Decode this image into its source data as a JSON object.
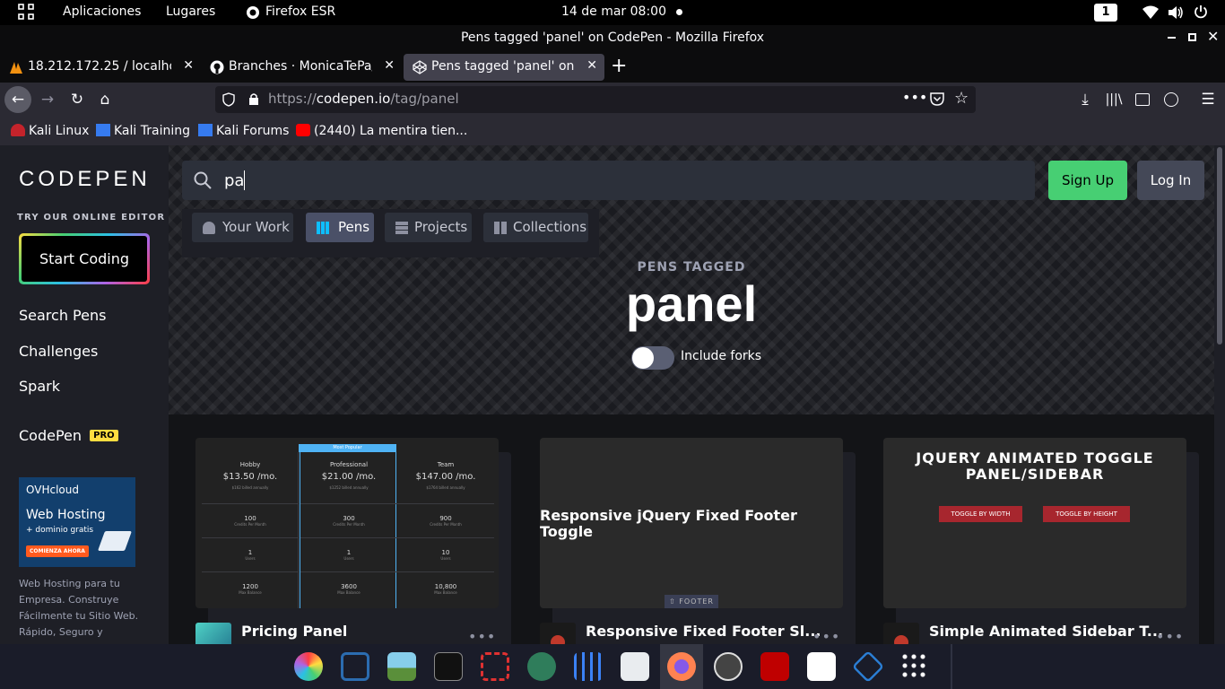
{
  "topbar": {
    "applications": "Aplicaciones",
    "places": "Lugares",
    "browser_app": "Firefox ESR",
    "datetime": "14 de mar  08:00",
    "workspace": "1"
  },
  "window": {
    "title": "Pens tagged 'panel' on CodePen - Mozilla Firefox"
  },
  "tabs": [
    {
      "label": "18.212.172.25 / localhost",
      "active": false
    },
    {
      "label": "Branches · MonicaTePa/F",
      "active": false
    },
    {
      "label": "Pens tagged 'panel' on Co",
      "active": true
    }
  ],
  "urlbar": {
    "url": "https://codepen.io/tag/panel",
    "url_host": "codepen.io",
    "url_prefix": "https://",
    "url_path": "/tag/panel"
  },
  "bookmarks": [
    {
      "label": "Kali Linux"
    },
    {
      "label": "Kali Training"
    },
    {
      "label": "Kali Forums"
    },
    {
      "label": "(2440) La mentira tien..."
    }
  ],
  "sidebar": {
    "logo": "CODEPEN",
    "try_label": "TRY OUR ONLINE EDITOR",
    "start_coding": "Start Coding",
    "links": [
      "Search Pens",
      "Challenges",
      "Spark"
    ],
    "codepen": "CodePen",
    "pro_badge": "PRO",
    "ad": {
      "brand": "OVHcloud",
      "headline": "Web Hosting",
      "subline": "+ dominio gratis",
      "cta": "COMIENZA AHORA",
      "text": "Web Hosting para tu Empresa. Construye Fácilmente tu Sitio Web. Rápido, Seguro y"
    }
  },
  "search": {
    "value": "pa",
    "tabs": [
      {
        "label": "Your Work",
        "active": false
      },
      {
        "label": "Pens",
        "active": true
      },
      {
        "label": "Projects",
        "active": false
      },
      {
        "label": "Collections",
        "active": false
      }
    ]
  },
  "header_buttons": {
    "sign_up": "Sign Up",
    "log_in": "Log In"
  },
  "hero": {
    "eyebrow": "PENS TAGGED",
    "tag": "panel",
    "toggle_label": "Include forks",
    "toggle_on": false
  },
  "cards": [
    {
      "title": "Pricing Panel",
      "more": "•••",
      "preview": {
        "popular": "Most Popular",
        "plans": [
          {
            "name": "Hobby",
            "price": "$13.50 /mo.",
            "billed": "$162 billed annually",
            "credits": "100",
            "users": "1",
            "balance": "1200"
          },
          {
            "name": "Professional",
            "price": "$21.00 /mo.",
            "billed": "$1252 billed annually",
            "credits": "300",
            "users": "1",
            "balance": "3600"
          },
          {
            "name": "Team",
            "price": "$147.00 /mo.",
            "billed": "$1764 billed annually",
            "credits": "900",
            "users": "10",
            "balance": "10,800"
          }
        ],
        "credits_label": "Credits Per Month",
        "users_label": "Users",
        "balance_label": "Max Balance"
      }
    },
    {
      "title": "Responsive Fixed Footer Sl...",
      "more": "•••",
      "preview": {
        "heading": "Responsive jQuery Fixed Footer Toggle",
        "footer_btn": "⇧ FOOTER"
      }
    },
    {
      "title": "Simple Animated Sidebar T...",
      "more": "•••",
      "preview": {
        "heading": "JQUERY ANIMATED TOGGLE PANEL/SIDEBAR",
        "btn1": "TOGGLE BY WIDTH",
        "btn2": "TOGGLE BY HEIGHT"
      }
    }
  ],
  "colors": {
    "signup_green": "#47cf73",
    "login_gray": "#444857",
    "pens_tab_active": "#4a5067",
    "toggle_btn_red": "#a7262e",
    "ovh_blue": "#123f6d",
    "pro_yellow": "#ffdd40"
  }
}
